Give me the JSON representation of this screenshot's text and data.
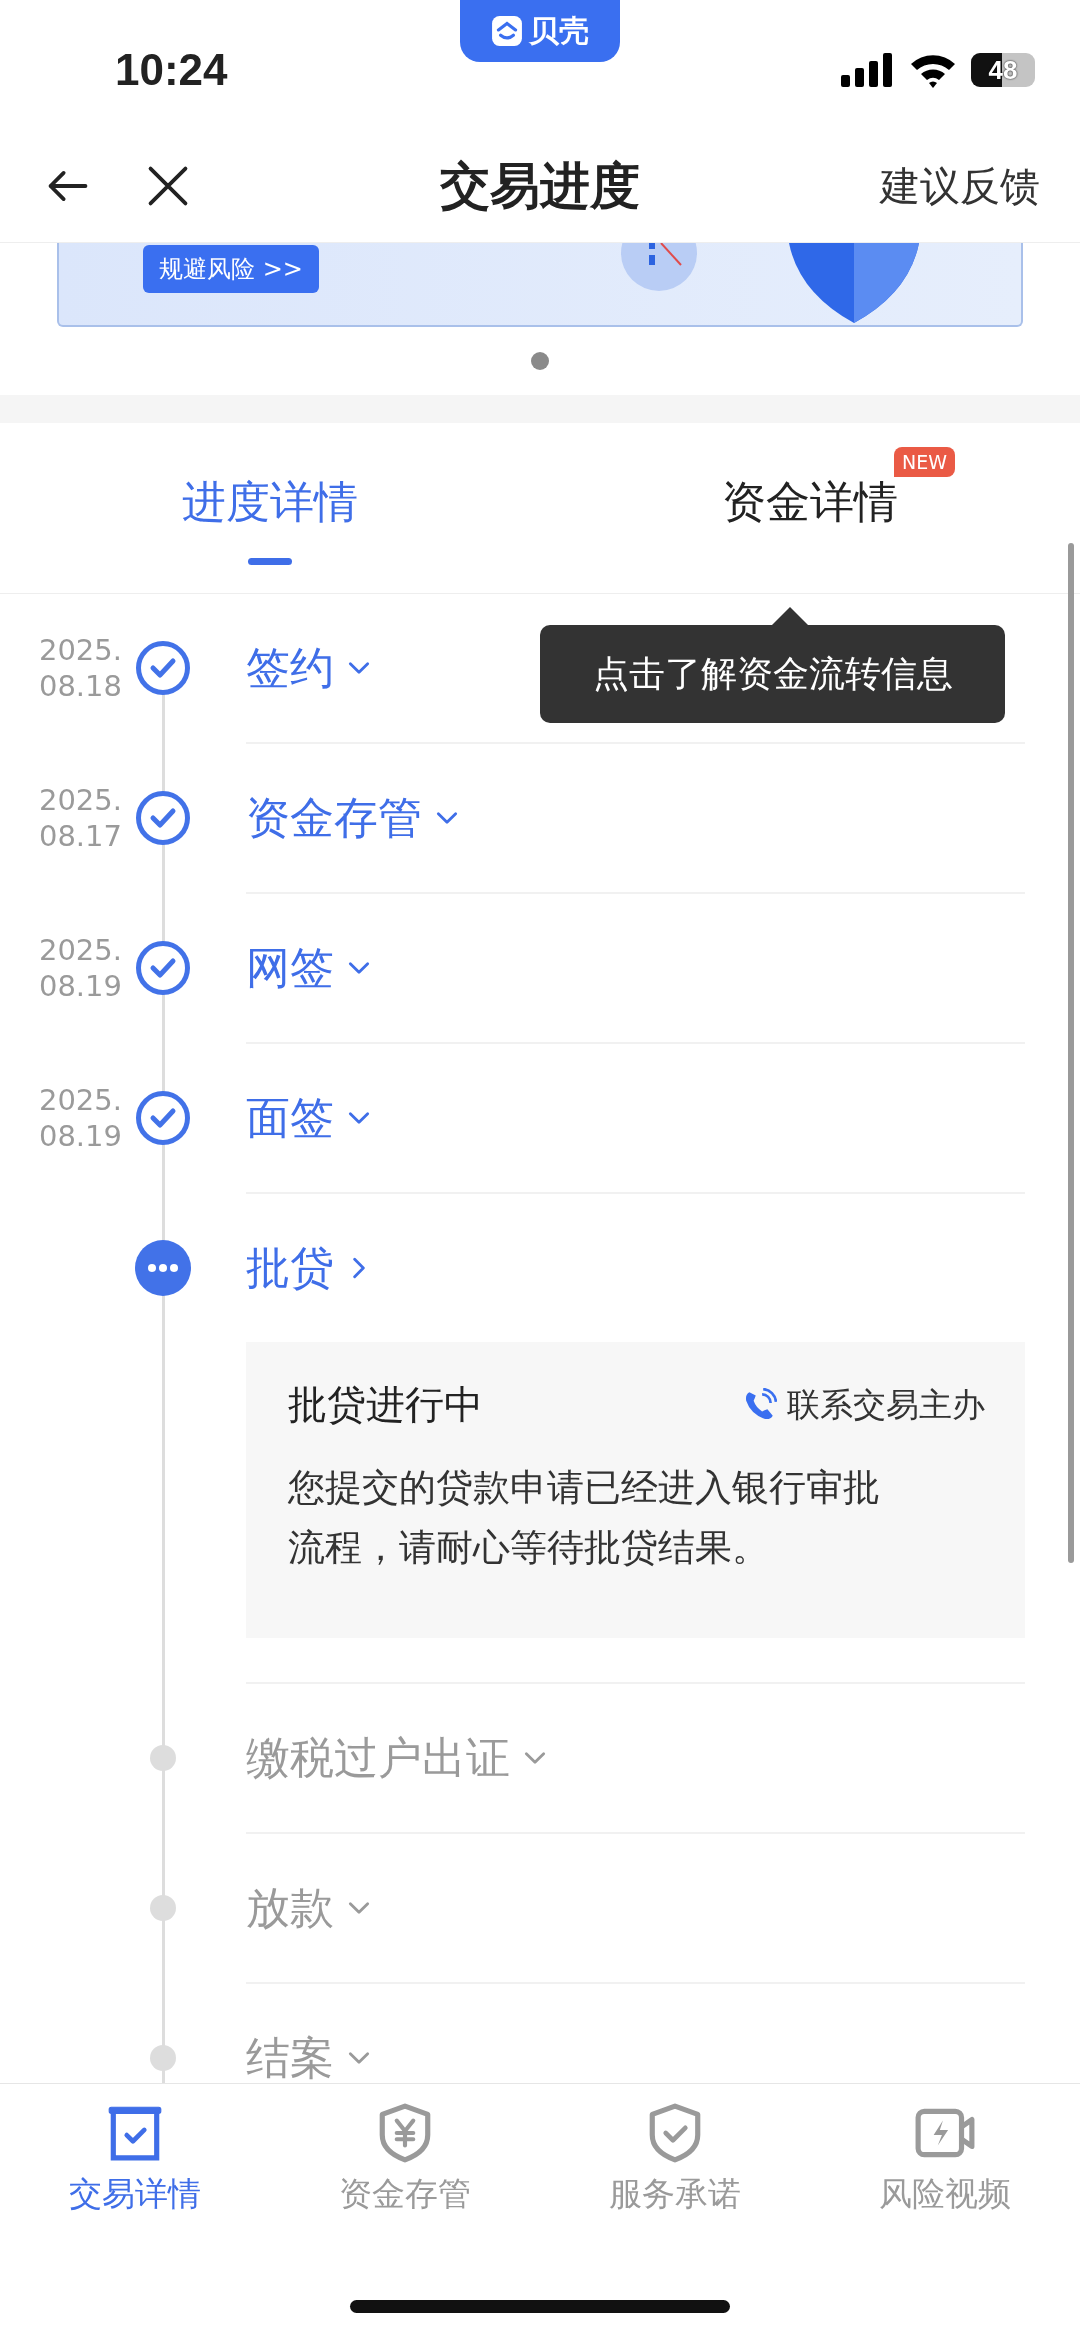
{
  "status_bar": {
    "time": "10:24",
    "app_pill": "贝壳",
    "battery": "48"
  },
  "nav": {
    "title": "交易进度",
    "action": "建议反馈"
  },
  "banner": {
    "button": "规避风险 >>"
  },
  "tabs": [
    {
      "label": "进度详情",
      "selected": true
    },
    {
      "label": "资金详情",
      "selected": false,
      "badge": "NEW"
    }
  ],
  "tooltip": "点击了解资金流转信息",
  "steps": [
    {
      "date_year": "2025.",
      "date_day": "08.18",
      "title": "签约",
      "kind": "done"
    },
    {
      "date_year": "2025.",
      "date_day": "08.17",
      "title": "资金存管",
      "kind": "done"
    },
    {
      "date_year": "2025.",
      "date_day": "08.19",
      "title": "网签",
      "kind": "done"
    },
    {
      "date_year": "2025.",
      "date_day": "08.19",
      "title": "面签",
      "kind": "done"
    },
    {
      "title": "批贷",
      "kind": "current",
      "card": {
        "title": "批贷进行中",
        "contact": "联系交易主办",
        "text": "您提交的贷款申请已经进入银行审批流程，请耐心等待批贷结果。"
      }
    },
    {
      "title": "缴税过户出证",
      "kind": "pending"
    },
    {
      "title": "放款",
      "kind": "pending"
    },
    {
      "title": "结案",
      "kind": "pending"
    }
  ],
  "bottom_nav": [
    {
      "label": "交易详情",
      "kind": "box",
      "selected": true
    },
    {
      "label": "资金存管",
      "kind": "shield-yen",
      "selected": false
    },
    {
      "label": "服务承诺",
      "kind": "shield-check",
      "selected": false
    },
    {
      "label": "风险视频",
      "kind": "video",
      "selected": false
    }
  ]
}
